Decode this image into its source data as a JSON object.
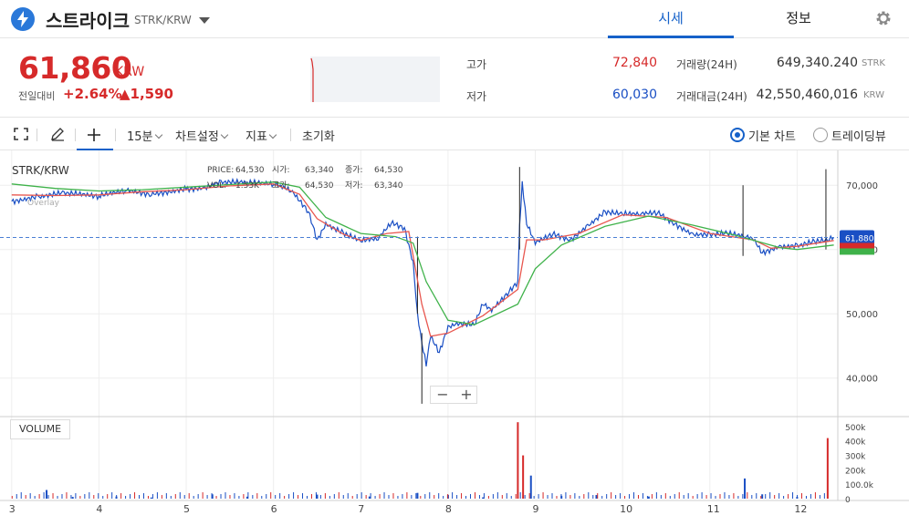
{
  "header": {
    "coin_name": "스트라이크",
    "pair": "STRK/KRW",
    "tabs": [
      "시세",
      "정보"
    ]
  },
  "price": {
    "current": "61,860",
    "unit": "KRW",
    "change_label": "전일대비",
    "change_pct": "+2.64%",
    "change_val": "▲1,590"
  },
  "stats": {
    "high_label": "고가",
    "high": "72,840",
    "low_label": "저가",
    "low": "60,030",
    "volume_label": "거래량(24H)",
    "volume": "649,340.240",
    "volume_unit": "STRK",
    "amount_label": "거래대금(24H)",
    "amount": "42,550,460,016",
    "amount_unit": "KRW"
  },
  "toolbar": {
    "interval": "15분",
    "chart_settings": "차트설정",
    "indicators": "지표",
    "reset": "초기화",
    "basic_chart": "기본 차트",
    "tradingview": "트레이딩뷰"
  },
  "legend": {
    "pair": "STRK/KRW",
    "price_label": "PRICE:",
    "price": "64,530",
    "open_label": "시가:",
    "open": "63,340",
    "close_label": "종가:",
    "close": "64,530",
    "vol_label": "VOL:",
    "vol": "1.53K",
    "high_label": "고가:",
    "high": "64,530",
    "low_label": "저가:",
    "low": "63,340",
    "overlay": "Overlay"
  },
  "price_tag": "61,880",
  "volume_label": "VOLUME",
  "zoom": {
    "minus": "−",
    "plus": "+"
  },
  "colors": {
    "up": "#d62a2a",
    "down": "#1a4fc4",
    "accent": "#1561c9",
    "ma_short": "#e8574f",
    "ma_long": "#3fb24a"
  },
  "chart_data": {
    "type": "line",
    "x_ticks": [
      "3",
      "4",
      "5",
      "6",
      "7",
      "8",
      "9",
      "10",
      "11",
      "12"
    ],
    "y_ticks": [
      "70,000",
      "60,000",
      "50,000",
      "40,000"
    ],
    "ylim": [
      34000,
      74000
    ],
    "volume_ticks": [
      "500k",
      "400k",
      "300k",
      "200k",
      "100.0k",
      "0"
    ],
    "volume_ylim": [
      0,
      550000
    ],
    "price_series": [
      [
        3.0,
        67500
      ],
      [
        3.3,
        68200
      ],
      [
        3.6,
        68800
      ],
      [
        4.0,
        68300
      ],
      [
        4.3,
        69200
      ],
      [
        4.6,
        68600
      ],
      [
        5.0,
        69400
      ],
      [
        5.2,
        69600
      ],
      [
        5.4,
        70500
      ],
      [
        5.7,
        70400
      ],
      [
        6.0,
        70200
      ],
      [
        6.2,
        69200
      ],
      [
        6.4,
        66000
      ],
      [
        6.5,
        61500
      ],
      [
        6.6,
        64000
      ],
      [
        6.8,
        62500
      ],
      [
        7.0,
        61300
      ],
      [
        7.2,
        61700
      ],
      [
        7.35,
        64200
      ],
      [
        7.5,
        63400
      ],
      [
        7.6,
        58000
      ],
      [
        7.65,
        50000
      ],
      [
        7.7,
        45500
      ],
      [
        7.75,
        42000
      ],
      [
        7.8,
        46500
      ],
      [
        7.9,
        44000
      ],
      [
        8.0,
        48000
      ],
      [
        8.1,
        48500
      ],
      [
        8.3,
        48200
      ],
      [
        8.4,
        51500
      ],
      [
        8.5,
        50500
      ],
      [
        8.7,
        53500
      ],
      [
        8.8,
        55000
      ],
      [
        8.82,
        63500
      ],
      [
        8.85,
        70500
      ],
      [
        8.9,
        64000
      ],
      [
        9.0,
        61000
      ],
      [
        9.2,
        62500
      ],
      [
        9.4,
        61500
      ],
      [
        9.6,
        63700
      ],
      [
        9.8,
        65800
      ],
      [
        10.0,
        65500
      ],
      [
        10.2,
        65500
      ],
      [
        10.4,
        65800
      ],
      [
        10.6,
        64000
      ],
      [
        10.8,
        62400
      ],
      [
        11.0,
        62300
      ],
      [
        11.2,
        62500
      ],
      [
        11.4,
        62000
      ],
      [
        11.5,
        61600
      ],
      [
        11.6,
        59500
      ],
      [
        11.8,
        60500
      ],
      [
        12.0,
        60600
      ],
      [
        12.2,
        61200
      ],
      [
        12.35,
        61400
      ],
      [
        12.42,
        61900
      ]
    ],
    "ma_short": [
      [
        3.0,
        68500
      ],
      [
        3.5,
        68400
      ],
      [
        4.0,
        68500
      ],
      [
        4.5,
        69000
      ],
      [
        5.0,
        69300
      ],
      [
        5.5,
        69900
      ],
      [
        6.0,
        70200
      ],
      [
        6.3,
        68600
      ],
      [
        6.5,
        64800
      ],
      [
        6.8,
        62400
      ],
      [
        7.0,
        61400
      ],
      [
        7.3,
        62500
      ],
      [
        7.55,
        62800
      ],
      [
        7.7,
        51500
      ],
      [
        7.8,
        46500
      ],
      [
        8.0,
        47000
      ],
      [
        8.4,
        49700
      ],
      [
        8.8,
        53800
      ],
      [
        8.9,
        61500
      ],
      [
        9.1,
        61500
      ],
      [
        9.5,
        62500
      ],
      [
        10.0,
        65400
      ],
      [
        10.5,
        65000
      ],
      [
        11.0,
        62500
      ],
      [
        11.5,
        61500
      ],
      [
        11.7,
        60200
      ],
      [
        12.0,
        60500
      ],
      [
        12.42,
        61400
      ]
    ],
    "ma_long": [
      [
        3.0,
        70200
      ],
      [
        3.5,
        69500
      ],
      [
        4.0,
        69100
      ],
      [
        4.5,
        69300
      ],
      [
        5.0,
        69700
      ],
      [
        5.5,
        70100
      ],
      [
        6.0,
        70500
      ],
      [
        6.3,
        69700
      ],
      [
        6.6,
        65000
      ],
      [
        7.0,
        62500
      ],
      [
        7.4,
        62000
      ],
      [
        7.6,
        61000
      ],
      [
        7.75,
        55000
      ],
      [
        8.0,
        49000
      ],
      [
        8.3,
        48300
      ],
      [
        8.8,
        51500
      ],
      [
        9.0,
        57000
      ],
      [
        9.3,
        60700
      ],
      [
        9.8,
        63600
      ],
      [
        10.3,
        65200
      ],
      [
        10.8,
        63800
      ],
      [
        11.3,
        62200
      ],
      [
        11.8,
        60300
      ],
      [
        12.0,
        60000
      ],
      [
        12.42,
        60700
      ]
    ],
    "volume_bars": [
      [
        3.4,
        60000
      ],
      [
        3.7,
        12000
      ],
      [
        4.2,
        15000
      ],
      [
        4.6,
        8000
      ],
      [
        5.3,
        30000
      ],
      [
        5.7,
        14000
      ],
      [
        6.5,
        28000
      ],
      [
        7.1,
        15000
      ],
      [
        7.65,
        40000
      ],
      [
        8.0,
        26000
      ],
      [
        8.4,
        9000
      ],
      [
        8.8,
        530000
      ],
      [
        8.86,
        300000
      ],
      [
        8.95,
        160000
      ],
      [
        9.3,
        20000
      ],
      [
        9.7,
        25000
      ],
      [
        10.3,
        15000
      ],
      [
        11.4,
        140000
      ],
      [
        11.6,
        30000
      ],
      [
        12.0,
        12000
      ],
      [
        12.35,
        420000
      ]
    ]
  }
}
